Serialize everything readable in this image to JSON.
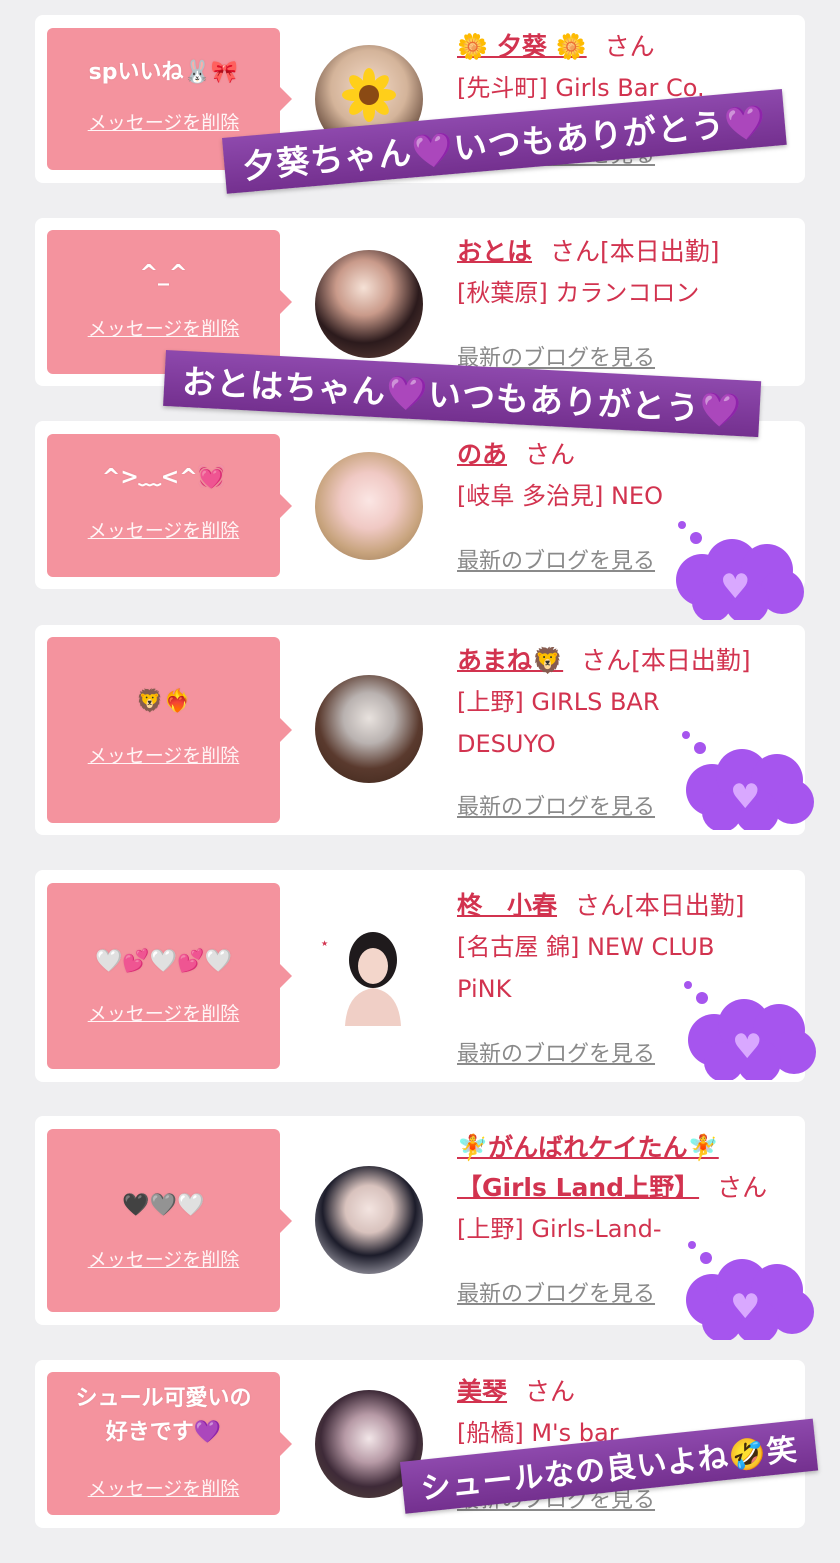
{
  "accent_pink": "#f4939e",
  "text_red": "#d2334f",
  "banner_purple": "#8e49ad",
  "cloud_purple": "#a655ee",
  "delete_label": "メッセージを削除",
  "blog_label": "最新のブログを見る",
  "san_label": "さん",
  "items": [
    {
      "message": "spいいね🐰🎀",
      "name": "🌼 夕葵 🌼",
      "status": "",
      "shop_line1": "[先斗町] Girls Bar Co.",
      "shop_line2": "",
      "avatar_icon": "sunflower-face-avatar"
    },
    {
      "message": "^_^",
      "name": "おとは",
      "status": "[本日出勤]",
      "shop_line1": "[秋葉原] カランコロン",
      "shop_line2": "",
      "avatar_icon": "avatar"
    },
    {
      "message": "^>﹏<^💓",
      "name": "のあ",
      "status": "",
      "shop_line1": "[岐阜 多治見] NEO",
      "shop_line2": "",
      "avatar_icon": "avatar"
    },
    {
      "message": "🦁❤️‍🔥",
      "name": "あまね🦁",
      "status": "[本日出勤]",
      "shop_line1": "[上野] GIRLS BAR",
      "shop_line2": "DESUYO",
      "avatar_icon": "avatar"
    },
    {
      "message": "🤍💕🤍💕🤍",
      "name": "柊　小春",
      "status": "[本日出勤]",
      "shop_line1": "[名古屋 錦] NEW CLUB",
      "shop_line2": "PiNK",
      "avatar_icon": "avatar"
    },
    {
      "message": "🖤🩶🤍",
      "name": "🧚がんばれケイたん🧚",
      "name2": "【Girls Land上野】",
      "status": "",
      "shop_line1": "[上野] Girls-Land-",
      "shop_line2": "",
      "avatar_icon": "avatar"
    },
    {
      "message": "シュール可愛いの",
      "message2": "好きです💜",
      "name": "美琴",
      "status": "",
      "shop_line1": "[船橋] M's bar",
      "shop_line2": "",
      "avatar_icon": "avatar"
    }
  ],
  "overlays": {
    "banner1": "夕葵ちゃん💜いつもありがとう💜",
    "banner2": "おとはちゃん💜いつもありがとう💜",
    "banner3": "シュールなの良いよね🤣笑",
    "cloud_heart": "💜"
  }
}
